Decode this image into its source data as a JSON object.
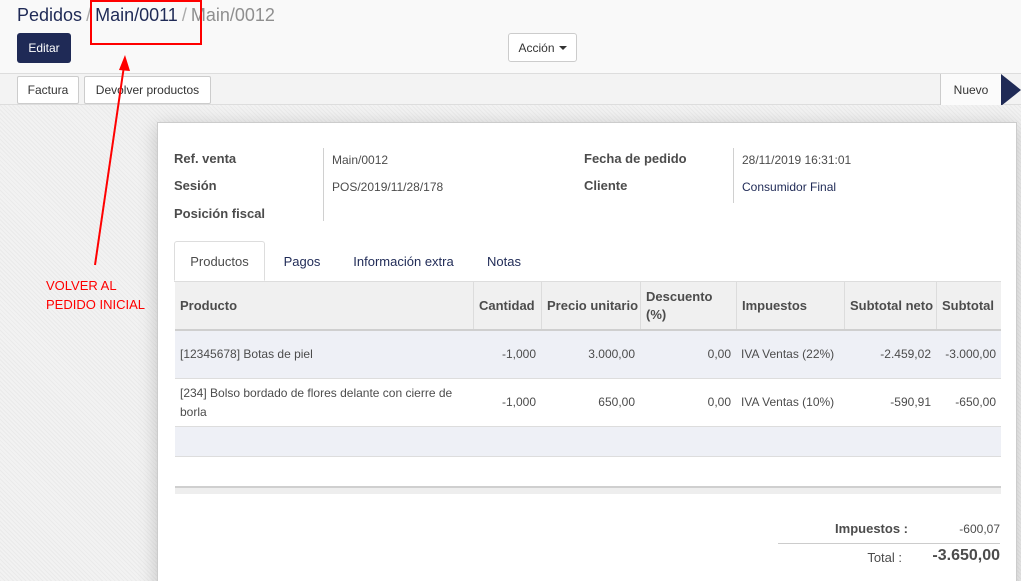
{
  "breadcrumb": {
    "items": [
      {
        "label": "Pedidos"
      },
      {
        "label": "Main/0011"
      },
      {
        "label": "Main/0012"
      }
    ],
    "separator": "/"
  },
  "toolbar": {
    "edit_label": "Editar",
    "action_label": "Acción"
  },
  "header": {
    "buttons": [
      {
        "label": "Factura"
      },
      {
        "label": "Devolver productos"
      }
    ],
    "stage": "Nuevo"
  },
  "form": {
    "fields_left": [
      {
        "label": "Ref. venta",
        "value": "Main/0012"
      },
      {
        "label": "Sesión",
        "value": "POS/2019/11/28/178"
      },
      {
        "label": "Posición fiscal",
        "value": ""
      }
    ],
    "fields_right": [
      {
        "label": "Fecha de pedido",
        "value": "28/11/2019 16:31:01"
      },
      {
        "label": "Cliente",
        "value": "Consumidor Final"
      }
    ]
  },
  "tabs": [
    {
      "label": "Productos",
      "active": true
    },
    {
      "label": "Pagos"
    },
    {
      "label": "Información extra"
    },
    {
      "label": "Notas"
    }
  ],
  "table": {
    "columns": [
      "Producto",
      "Cantidad",
      "Precio unitario",
      "Descuento (%)",
      "Impuestos",
      "Subtotal neto",
      "Subtotal"
    ],
    "rows": [
      {
        "producto": "[12345678] Botas de piel",
        "cantidad": "-1,000",
        "precio": "3.000,00",
        "descuento": "0,00",
        "impuestos": "IVA Ventas (22%)",
        "subtotal_neto": "-2.459,02",
        "subtotal": "-3.000,00"
      },
      {
        "producto": "[234] Bolso bordado de flores delante con cierre de borla",
        "cantidad": "-1,000",
        "precio": "650,00",
        "descuento": "0,00",
        "impuestos": "IVA Ventas (10%)",
        "subtotal_neto": "-590,91",
        "subtotal": "-650,00"
      }
    ]
  },
  "totals": {
    "impuestos_label": "Impuestos :",
    "impuestos_value": "-600,07",
    "total_label": "Total :",
    "total_value": "-3.650,00"
  },
  "annotation": {
    "line1": "VOLVER AL",
    "line2": "PEDIDO INICIAL",
    "color": "#ff0000"
  },
  "colors": {
    "brand": "#1f2a56",
    "annotation": "#ff0000"
  }
}
